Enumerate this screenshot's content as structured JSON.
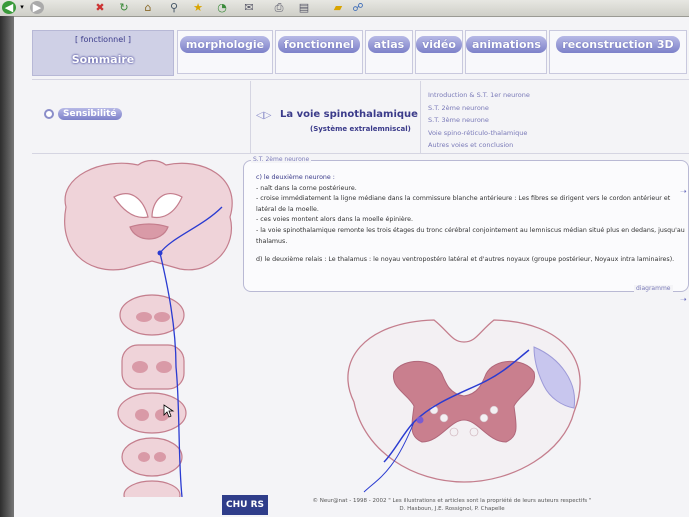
{
  "nav": {
    "category": "[ fonctionnel ]",
    "summary": "Sommaire",
    "tabs": [
      "morphologie",
      "fonctionnel",
      "atlas",
      "vidéo",
      "animations",
      "reconstruction 3D"
    ]
  },
  "section": {
    "sensibility_label": "Sensibilité",
    "arrows": "◁▷",
    "title": "La voie spinothalamique",
    "subtitle": "(Système extralemniscal)",
    "sub_links": [
      "Introduction & S.T. 1er neurone",
      "S.T. 2ème neurone",
      "S.T. 3ème neurone",
      "Voie spino-réticulo-thalamique",
      "Autres voies et conclusion"
    ]
  },
  "textbox": {
    "legend": "S.T. 2ème neurone",
    "heading": "c) le deuxième neurone :",
    "lines": [
      "- naît dans la corne postérieure.",
      "- croise immédiatement la ligne médiane dans la commissure blanche antérieure : Les fibres se dirigent vers le cordon antérieur et latéral de la moelle.",
      "- ces voies montent alors dans la moelle épinière.",
      "- la voie spinothalamique remonte les trois étages du tronc cérébral conjointement au lemniscus médian situé plus en dedans, jusqu'au thalamus."
    ],
    "relay": "d) le deuxième relais : Le thalamus : le noyau ventropostéro latéral et d'autres noyaux (groupe postérieur, Noyaux intra laminaires).",
    "diagram_label": "diagramme"
  },
  "footer": {
    "logo": "CHU RS",
    "line1": "© Neur@nat - 1998 - 2002 \" Les illustrations et articles sont la propriété de leurs auteurs respectifs \"",
    "line2": "D. Hasboun, J.E. Rossignol, P. Chapelle"
  },
  "colors": {
    "accent": "#7d81c9",
    "tissue_pink": "#e8c7cf",
    "gray_matter": "#c97f8e",
    "pathway_blue": "#2a3bd1"
  }
}
